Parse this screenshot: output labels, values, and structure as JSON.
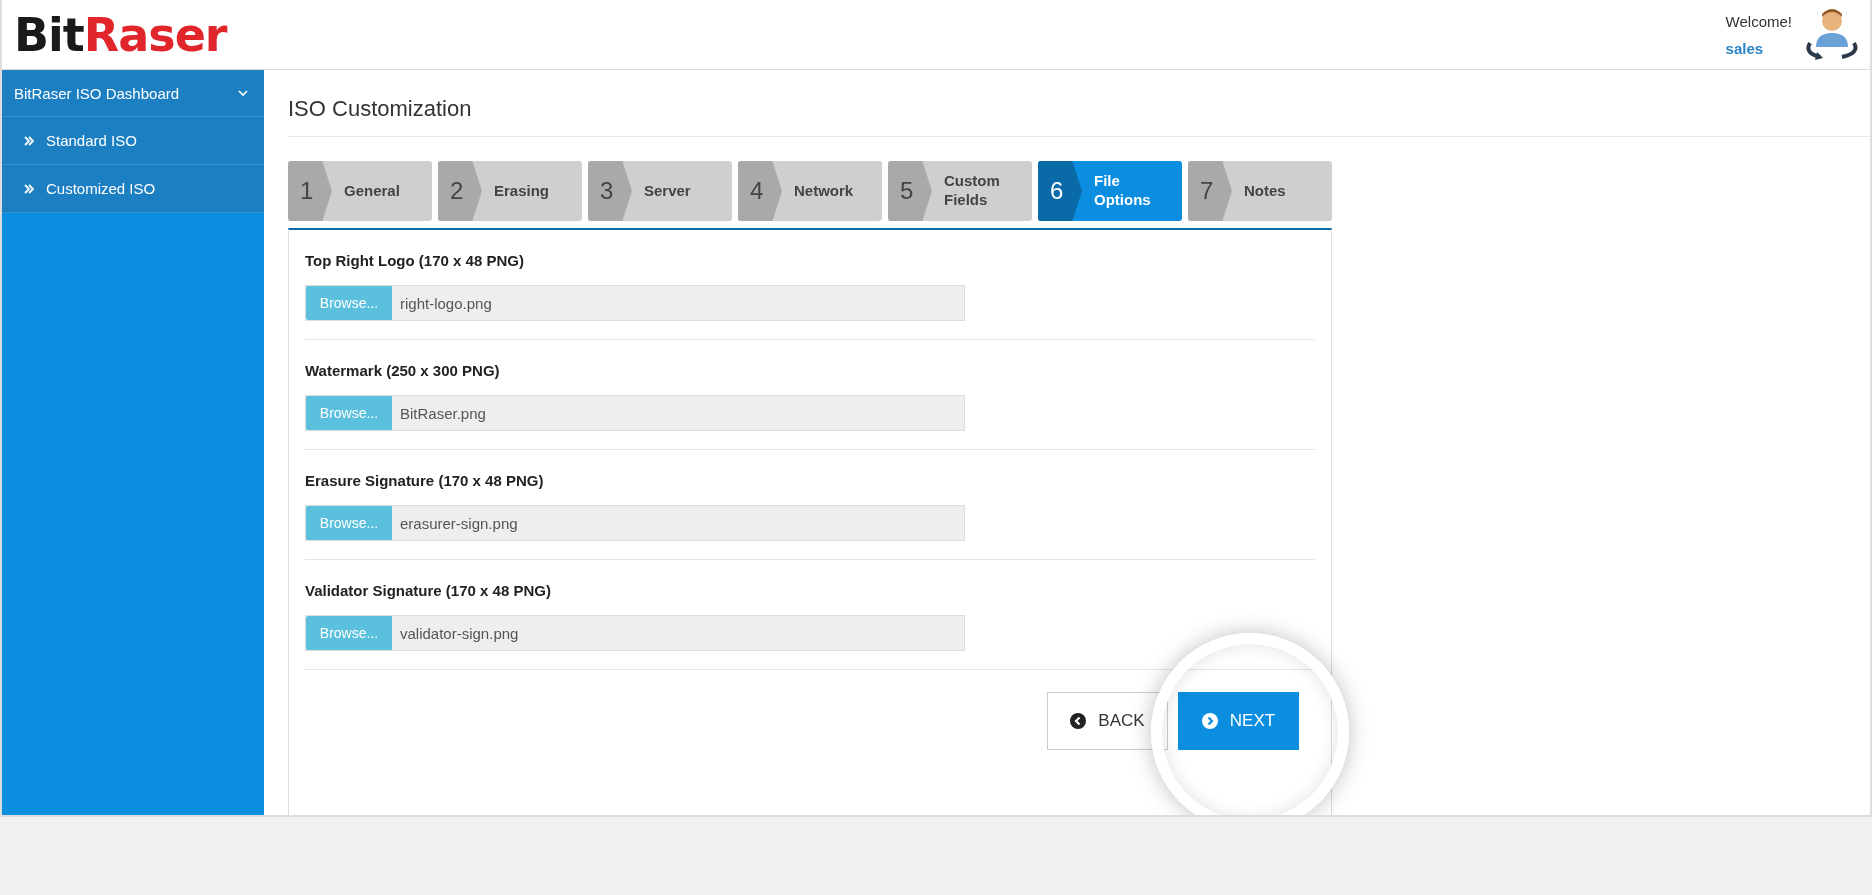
{
  "header": {
    "logo": {
      "dark": "Bit",
      "accent": "Raser"
    },
    "greeting": "Welcome!",
    "username": "sales"
  },
  "sidebar": {
    "title": "BitRaser ISO Dashboard",
    "expanded": true,
    "items": [
      {
        "label": "Standard ISO",
        "selected": false
      },
      {
        "label": "Customized ISO",
        "selected": false
      }
    ]
  },
  "page_title": "ISO Customization",
  "steps": [
    {
      "number": "1",
      "label": "General",
      "selected": false
    },
    {
      "number": "2",
      "label": "Erasing",
      "selected": false
    },
    {
      "number": "3",
      "label": "Server",
      "selected": false
    },
    {
      "number": "4",
      "label": "Network",
      "selected": false
    },
    {
      "number": "5",
      "label": "Custom Fields",
      "selected": false
    },
    {
      "number": "6",
      "label": "File Options",
      "selected": true
    },
    {
      "number": "7",
      "label": "Notes",
      "selected": false
    }
  ],
  "file_fields": [
    {
      "label": "Top Right Logo (170 x 48 PNG)",
      "button": "Browse...",
      "value": "right-logo.png"
    },
    {
      "label": "Watermark (250 x 300 PNG)",
      "button": "Browse...",
      "value": "BitRaser.png"
    },
    {
      "label": "Erasure Signature (170 x 48 PNG)",
      "button": "Browse...",
      "value": "erasurer-sign.png"
    },
    {
      "label": "Validator Signature (170 x 48 PNG)",
      "button": "Browse...",
      "value": "validator-sign.png"
    }
  ],
  "buttons": [
    {
      "kind": "back",
      "label": "BACK",
      "highlighted": false
    },
    {
      "kind": "next",
      "label": "NEXT",
      "highlighted": true
    }
  ]
}
